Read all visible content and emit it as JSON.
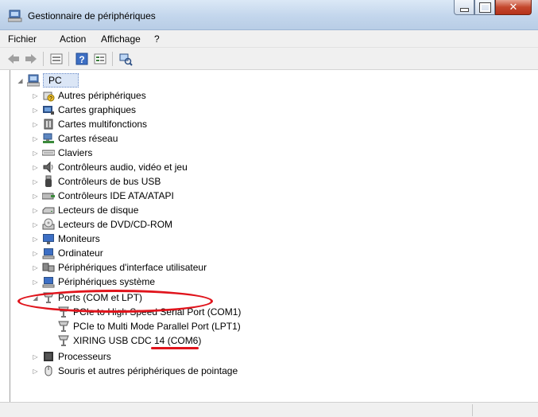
{
  "window": {
    "title": "Gestionnaire de périphériques"
  },
  "menu": {
    "items": [
      "Fichier",
      "Action",
      "Affichage",
      "?"
    ]
  },
  "tree": {
    "root": "PC",
    "categories": [
      {
        "label": "Autres périphériques",
        "icon": "unknown-device-icon"
      },
      {
        "label": "Cartes graphiques",
        "icon": "display-adapter-icon"
      },
      {
        "label": "Cartes multifonctions",
        "icon": "multifunction-card-icon"
      },
      {
        "label": "Cartes réseau",
        "icon": "network-adapter-icon"
      },
      {
        "label": "Claviers",
        "icon": "keyboard-icon"
      },
      {
        "label": "Contrôleurs audio, vidéo et jeu",
        "icon": "speaker-icon"
      },
      {
        "label": "Contrôleurs de bus USB",
        "icon": "usb-icon"
      },
      {
        "label": "Contrôleurs IDE ATA/ATAPI",
        "icon": "ide-controller-icon"
      },
      {
        "label": "Lecteurs de disque",
        "icon": "disk-drive-icon"
      },
      {
        "label": "Lecteurs de DVD/CD-ROM",
        "icon": "dvd-drive-icon"
      },
      {
        "label": "Moniteurs",
        "icon": "monitor-icon"
      },
      {
        "label": "Ordinateur",
        "icon": "computer-icon"
      },
      {
        "label": "Périphériques d'interface utilisateur",
        "icon": "hid-icon"
      },
      {
        "label": "Périphériques système",
        "icon": "system-device-icon"
      }
    ],
    "ports": {
      "label": "Ports (COM et LPT)",
      "children": [
        "PCIe to High Speed Serial Port (COM1)",
        "PCIe to Multi Mode Parallel Port (LPT1)",
        "XIRING USB CDC 14 (COM6)"
      ]
    },
    "after": [
      {
        "label": "Processeurs",
        "icon": "processor-icon"
      },
      {
        "label": "Souris et autres périphériques de pointage",
        "icon": "mouse-icon"
      }
    ]
  },
  "annotation_color": "#e0141c"
}
